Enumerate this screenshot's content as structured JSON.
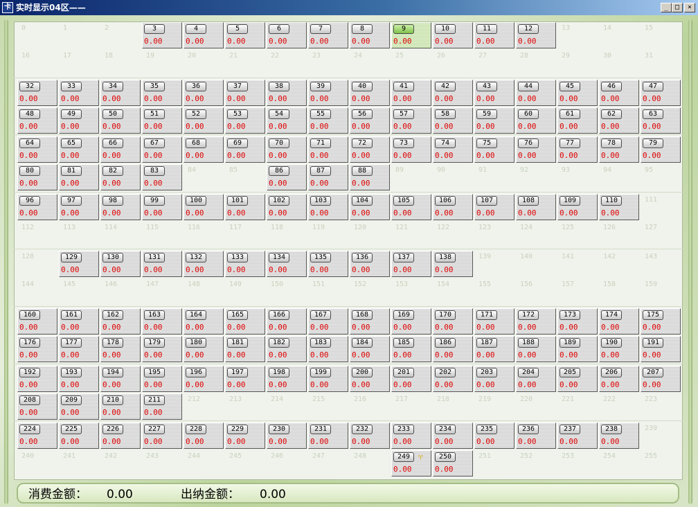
{
  "window": {
    "title": "实时显示04区——",
    "minimize": "_",
    "maximize": "□",
    "close": "×"
  },
  "colors": {
    "amount": "#e00000",
    "selected": "#9bd46a",
    "pending_flag": "#d8a800"
  },
  "terminals": [
    {
      "id": "3",
      "amount": "0.00"
    },
    {
      "id": "4",
      "amount": "0.00"
    },
    {
      "id": "5",
      "amount": "0.00"
    },
    {
      "id": "6",
      "amount": "0.00"
    },
    {
      "id": "7",
      "amount": "0.00"
    },
    {
      "id": "8",
      "amount": "0.00"
    },
    {
      "id": "9",
      "amount": "0.00",
      "selected": true
    },
    {
      "id": "10",
      "amount": "0.00"
    },
    {
      "id": "11",
      "amount": "0.00"
    },
    {
      "id": "12",
      "amount": "0.00"
    },
    {
      "id": "32",
      "amount": "0.00"
    },
    {
      "id": "33",
      "amount": "0.00"
    },
    {
      "id": "34",
      "amount": "0.00"
    },
    {
      "id": "35",
      "amount": "0.00"
    },
    {
      "id": "36",
      "amount": "0.00"
    },
    {
      "id": "37",
      "amount": "0.00"
    },
    {
      "id": "38",
      "amount": "0.00"
    },
    {
      "id": "39",
      "amount": "0.00"
    },
    {
      "id": "40",
      "amount": "0.00"
    },
    {
      "id": "41",
      "amount": "0.00"
    },
    {
      "id": "42",
      "amount": "0.00"
    },
    {
      "id": "43",
      "amount": "0.00"
    },
    {
      "id": "44",
      "amount": "0.00"
    },
    {
      "id": "45",
      "amount": "0.00"
    },
    {
      "id": "46",
      "amount": "0.00"
    },
    {
      "id": "47",
      "amount": "0.00"
    },
    {
      "id": "48",
      "amount": "0.00"
    },
    {
      "id": "49",
      "amount": "0.00"
    },
    {
      "id": "50",
      "amount": "0.00"
    },
    {
      "id": "51",
      "amount": "0.00"
    },
    {
      "id": "52",
      "amount": "0.00"
    },
    {
      "id": "53",
      "amount": "0.00"
    },
    {
      "id": "54",
      "amount": "0.00"
    },
    {
      "id": "55",
      "amount": "0.00"
    },
    {
      "id": "56",
      "amount": "0.00"
    },
    {
      "id": "57",
      "amount": "0.00"
    },
    {
      "id": "58",
      "amount": "0.00"
    },
    {
      "id": "59",
      "amount": "0.00"
    },
    {
      "id": "60",
      "amount": "0.00"
    },
    {
      "id": "61",
      "amount": "0.00"
    },
    {
      "id": "62",
      "amount": "0.00"
    },
    {
      "id": "63",
      "amount": "0.00"
    },
    {
      "id": "64",
      "amount": "0.00"
    },
    {
      "id": "65",
      "amount": "0.00"
    },
    {
      "id": "66",
      "amount": "0.00"
    },
    {
      "id": "67",
      "amount": "0.00"
    },
    {
      "id": "68",
      "amount": "0.00"
    },
    {
      "id": "69",
      "amount": "0.00"
    },
    {
      "id": "70",
      "amount": "0.00"
    },
    {
      "id": "71",
      "amount": "0.00"
    },
    {
      "id": "72",
      "amount": "0.00"
    },
    {
      "id": "73",
      "amount": "0.00"
    },
    {
      "id": "74",
      "amount": "0.00"
    },
    {
      "id": "75",
      "amount": "0.00"
    },
    {
      "id": "76",
      "amount": "0.00"
    },
    {
      "id": "77",
      "amount": "0.00"
    },
    {
      "id": "78",
      "amount": "0.00"
    },
    {
      "id": "79",
      "amount": "0.00"
    },
    {
      "id": "80",
      "amount": "0.00"
    },
    {
      "id": "81",
      "amount": "0.00"
    },
    {
      "id": "82",
      "amount": "0.00"
    },
    {
      "id": "83",
      "amount": "0.00"
    },
    {
      "id": "86",
      "amount": "0.00"
    },
    {
      "id": "87",
      "amount": "0.00"
    },
    {
      "id": "88",
      "amount": "0.00"
    },
    {
      "id": "96",
      "amount": "0.00"
    },
    {
      "id": "97",
      "amount": "0.00"
    },
    {
      "id": "98",
      "amount": "0.00"
    },
    {
      "id": "99",
      "amount": "0.00"
    },
    {
      "id": "100",
      "amount": "0.00"
    },
    {
      "id": "101",
      "amount": "0.00"
    },
    {
      "id": "102",
      "amount": "0.00"
    },
    {
      "id": "103",
      "amount": "0.00"
    },
    {
      "id": "104",
      "amount": "0.00"
    },
    {
      "id": "105",
      "amount": "0.00"
    },
    {
      "id": "106",
      "amount": "0.00"
    },
    {
      "id": "107",
      "amount": "0.00"
    },
    {
      "id": "108",
      "amount": "0.00"
    },
    {
      "id": "109",
      "amount": "0.00"
    },
    {
      "id": "110",
      "amount": "0.00"
    },
    {
      "id": "129",
      "amount": "0.00"
    },
    {
      "id": "130",
      "amount": "0.00"
    },
    {
      "id": "131",
      "amount": "0.00"
    },
    {
      "id": "132",
      "amount": "0.00"
    },
    {
      "id": "133",
      "amount": "0.00"
    },
    {
      "id": "134",
      "amount": "0.00"
    },
    {
      "id": "135",
      "amount": "0.00"
    },
    {
      "id": "136",
      "amount": "0.00"
    },
    {
      "id": "137",
      "amount": "0.00"
    },
    {
      "id": "138",
      "amount": "0.00"
    },
    {
      "id": "160",
      "amount": "0.00"
    },
    {
      "id": "161",
      "amount": "0.00"
    },
    {
      "id": "162",
      "amount": "0.00"
    },
    {
      "id": "163",
      "amount": "0.00"
    },
    {
      "id": "164",
      "amount": "0.00"
    },
    {
      "id": "165",
      "amount": "0.00"
    },
    {
      "id": "166",
      "amount": "0.00"
    },
    {
      "id": "167",
      "amount": "0.00"
    },
    {
      "id": "168",
      "amount": "0.00"
    },
    {
      "id": "169",
      "amount": "0.00"
    },
    {
      "id": "170",
      "amount": "0.00"
    },
    {
      "id": "171",
      "amount": "0.00"
    },
    {
      "id": "172",
      "amount": "0.00"
    },
    {
      "id": "173",
      "amount": "0.00"
    },
    {
      "id": "174",
      "amount": "0.00"
    },
    {
      "id": "175",
      "amount": "0.00"
    },
    {
      "id": "176",
      "amount": "0.00"
    },
    {
      "id": "177",
      "amount": "0.00"
    },
    {
      "id": "178",
      "amount": "0.00"
    },
    {
      "id": "179",
      "amount": "0.00"
    },
    {
      "id": "180",
      "amount": "0.00"
    },
    {
      "id": "181",
      "amount": "0.00"
    },
    {
      "id": "182",
      "amount": "0.00"
    },
    {
      "id": "183",
      "amount": "0.00"
    },
    {
      "id": "184",
      "amount": "0.00"
    },
    {
      "id": "185",
      "amount": "0.00"
    },
    {
      "id": "186",
      "amount": "0.00"
    },
    {
      "id": "187",
      "amount": "0.00"
    },
    {
      "id": "188",
      "amount": "0.00"
    },
    {
      "id": "189",
      "amount": "0.00"
    },
    {
      "id": "190",
      "amount": "0.00"
    },
    {
      "id": "191",
      "amount": "0.00"
    },
    {
      "id": "192",
      "amount": "0.00"
    },
    {
      "id": "193",
      "amount": "0.00"
    },
    {
      "id": "194",
      "amount": "0.00"
    },
    {
      "id": "195",
      "amount": "0.00"
    },
    {
      "id": "196",
      "amount": "0.00"
    },
    {
      "id": "197",
      "amount": "0.00"
    },
    {
      "id": "198",
      "amount": "0.00"
    },
    {
      "id": "199",
      "amount": "0.00"
    },
    {
      "id": "200",
      "amount": "0.00"
    },
    {
      "id": "201",
      "amount": "0.00"
    },
    {
      "id": "202",
      "amount": "0.00"
    },
    {
      "id": "203",
      "amount": "0.00"
    },
    {
      "id": "204",
      "amount": "0.00"
    },
    {
      "id": "205",
      "amount": "0.00"
    },
    {
      "id": "206",
      "amount": "0.00"
    },
    {
      "id": "207",
      "amount": "0.00"
    },
    {
      "id": "208",
      "amount": "0.00"
    },
    {
      "id": "209",
      "amount": "0.00"
    },
    {
      "id": "210",
      "amount": "0.00"
    },
    {
      "id": "211",
      "amount": "0.00"
    },
    {
      "id": "224",
      "amount": "0.00"
    },
    {
      "id": "225",
      "amount": "0.00"
    },
    {
      "id": "226",
      "amount": "0.00"
    },
    {
      "id": "227",
      "amount": "0.00"
    },
    {
      "id": "228",
      "amount": "0.00"
    },
    {
      "id": "229",
      "amount": "0.00"
    },
    {
      "id": "230",
      "amount": "0.00"
    },
    {
      "id": "231",
      "amount": "0.00"
    },
    {
      "id": "232",
      "amount": "0.00"
    },
    {
      "id": "233",
      "amount": "0.00"
    },
    {
      "id": "234",
      "amount": "0.00"
    },
    {
      "id": "235",
      "amount": "0.00"
    },
    {
      "id": "236",
      "amount": "0.00"
    },
    {
      "id": "237",
      "amount": "0.00"
    },
    {
      "id": "238",
      "amount": "0.00"
    },
    {
      "id": "249",
      "amount": "0.00",
      "pending": true,
      "flag_glyph": "♈"
    },
    {
      "id": "250",
      "amount": "0.00"
    }
  ],
  "empty_slots": [
    "0",
    "1",
    "2",
    "13",
    "14",
    "15",
    "16",
    "17",
    "18",
    "19",
    "20",
    "21",
    "22",
    "23",
    "24",
    "25",
    "26",
    "27",
    "28",
    "29",
    "30",
    "31",
    "84",
    "85",
    "89",
    "90",
    "91",
    "92",
    "93",
    "94",
    "95",
    "111",
    "112",
    "113",
    "114",
    "115",
    "116",
    "117",
    "118",
    "119",
    "120",
    "121",
    "122",
    "123",
    "124",
    "125",
    "126",
    "127",
    "128",
    "139",
    "140",
    "141",
    "142",
    "143",
    "144",
    "145",
    "146",
    "147",
    "148",
    "149",
    "150",
    "151",
    "152",
    "153",
    "154",
    "155",
    "156",
    "157",
    "158",
    "159",
    "212",
    "213",
    "214",
    "215",
    "216",
    "217",
    "218",
    "219",
    "220",
    "221",
    "222",
    "223",
    "239",
    "240",
    "241",
    "242",
    "243",
    "244",
    "245",
    "246",
    "247",
    "248",
    "251",
    "252",
    "253",
    "254",
    "255"
  ],
  "status": {
    "consume_label": "消费金额：",
    "consume_value": "0.00",
    "cashier_label": "出纳金额：",
    "cashier_value": "0.00"
  }
}
